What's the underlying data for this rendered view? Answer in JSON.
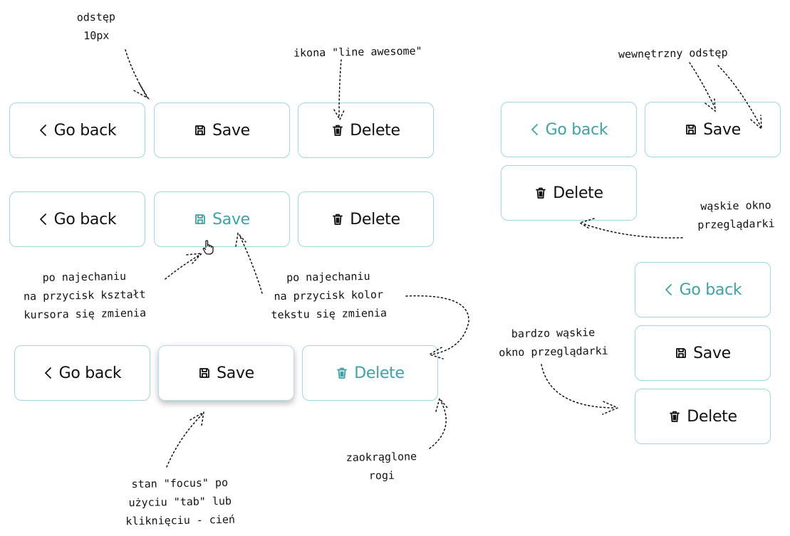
{
  "buttons": {
    "go_back": "Go back",
    "save": "Save",
    "delete": "Delete"
  },
  "annotations": {
    "spacing": "odstęp\n10px",
    "icon": "ikona \"line awesome\"",
    "inner_padding": "wewnętrzny odstęp",
    "narrow_window": "wąskie okno\nprzeglądarki",
    "hover_cursor": "po najechaniu\nna przycisk kształt\nkursora się zmienia",
    "hover_color": "po najechaniu\nna przycisk kolor\ntekstu się zmienia",
    "very_narrow_window": "bardzo wąskie\nokno przeglądarki",
    "rounded_corners": "zaokrąglone\nrogi",
    "focus_state": "stan \"focus\" po\nużyciu \"tab\" lub\nkliknięciu - cień"
  },
  "icons": {
    "back": "chevron-left-icon",
    "save": "floppy-disk-icon",
    "delete": "trash-icon"
  },
  "colors": {
    "border": "#9fd6e3",
    "hover_text": "#3aa4a8",
    "text": "#111111"
  }
}
